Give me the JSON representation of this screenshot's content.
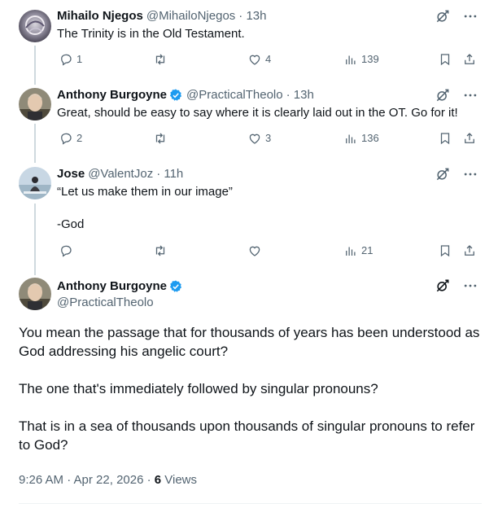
{
  "tweets": [
    {
      "name": "Mihailo Njegos",
      "handle": "@MihailoNjegos",
      "time": "· 13h",
      "verified": false,
      "text": "The Trinity is in the Old Testament.",
      "replies": "1",
      "retweets": "",
      "likes": "4",
      "views": "139"
    },
    {
      "name": "Anthony Burgoyne",
      "handle": "@PracticalTheolo",
      "time": "· 13h",
      "verified": true,
      "text": "Great, should be easy to say where it is clearly laid out in the OT. Go for it!",
      "replies": "2",
      "retweets": "",
      "likes": "3",
      "views": "136"
    },
    {
      "name": "Jose",
      "handle": "@ValentJoz",
      "time": "· 11h",
      "verified": false,
      "text_lines": [
        "“Let us make them in our image”",
        "",
        "-God"
      ],
      "replies": "",
      "retweets": "",
      "likes": "",
      "views": "21"
    }
  ],
  "main": {
    "name": "Anthony Burgoyne",
    "handle": "@PracticalTheolo",
    "paragraphs": [
      "You mean the passage that for thousands of years has been understood as God addressing his angelic court?",
      "The one that's immediately followed by singular pronouns?",
      "That is in a sea of thousands upon thousands of singular pronouns to refer to God?"
    ],
    "timestamp": "9:26 AM · Apr 22, 2026 · ",
    "views_count": "6",
    "views_label": " Views"
  },
  "icons": {
    "reply": "reply-icon",
    "retweet": "retweet-icon",
    "like": "heart-icon",
    "views": "views-icon",
    "bookmark": "bookmark-icon",
    "share": "share-icon",
    "grok": "grok-icon",
    "more": "more-icon",
    "verified": "verified-badge-icon"
  },
  "colors": {
    "text": "#0f1419",
    "secondary": "#536471",
    "verified": "#1d9bf0",
    "line": "#cfd9de"
  }
}
